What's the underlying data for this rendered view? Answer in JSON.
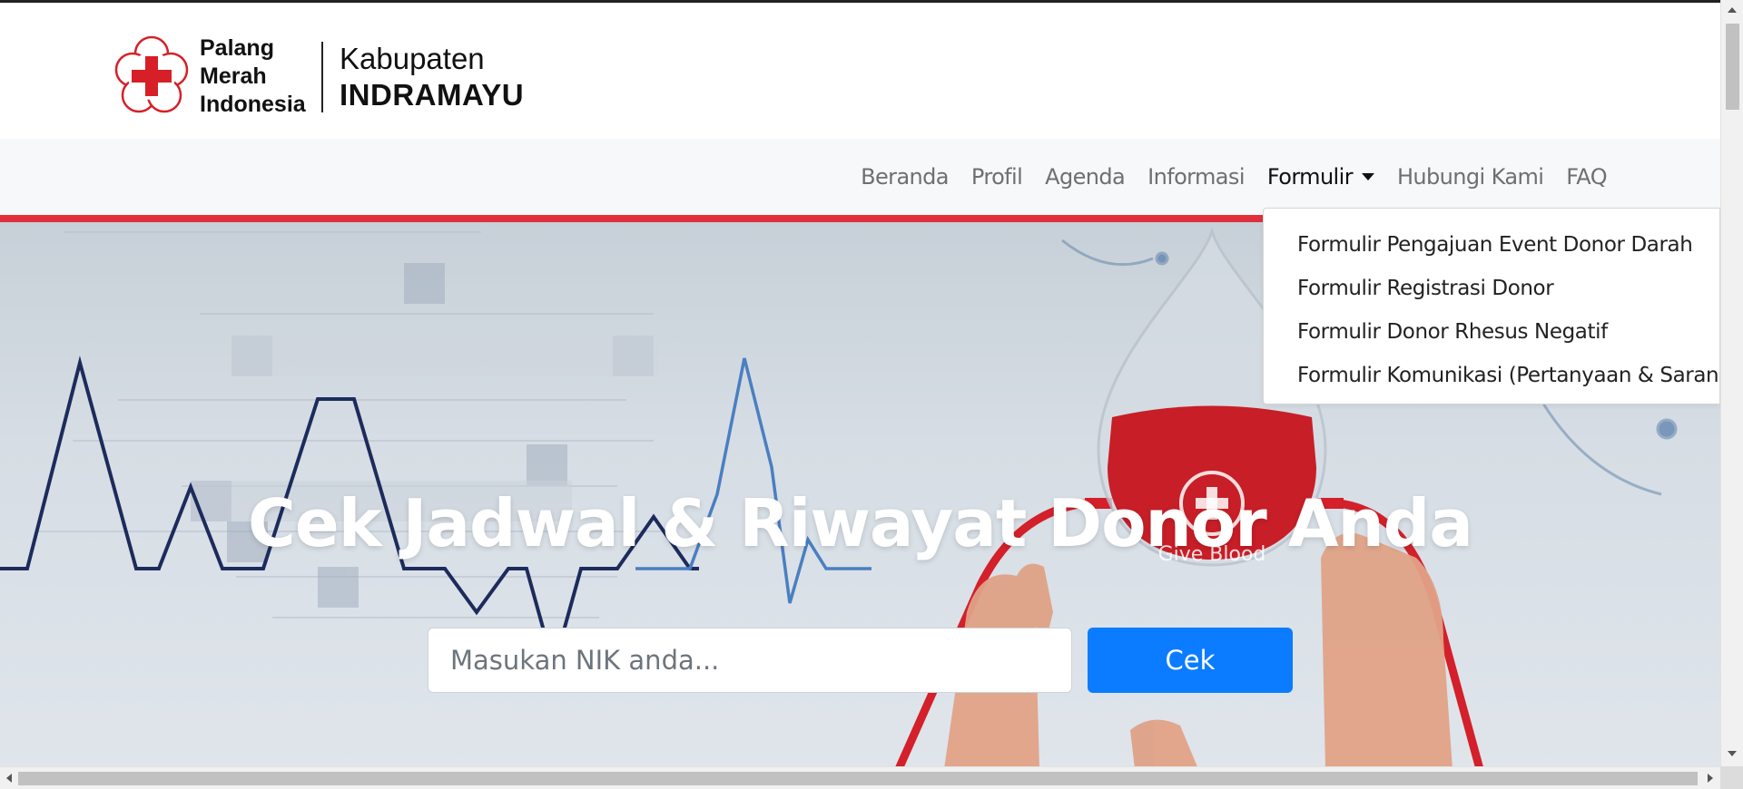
{
  "brand": {
    "pmi_line1": "Palang",
    "pmi_line2": "Merah",
    "pmi_line3": "Indonesia",
    "region_line1": "Kabupaten",
    "region_line2": "INDRAMAYU"
  },
  "nav": {
    "items": [
      {
        "label": "Beranda"
      },
      {
        "label": "Profil"
      },
      {
        "label": "Agenda"
      },
      {
        "label": "Informasi"
      },
      {
        "label": "Formulir"
      },
      {
        "label": "Hubungi Kami"
      },
      {
        "label": "FAQ"
      }
    ]
  },
  "dropdown": {
    "items": [
      {
        "label": "Formulir Pengajuan Event Donor Darah"
      },
      {
        "label": "Formulir Registrasi Donor"
      },
      {
        "label": "Formulir Donor Rhesus Negatif"
      },
      {
        "label": "Formulir Komunikasi (Pertanyaan & Saran)"
      }
    ]
  },
  "hero": {
    "title": "Cek Jadwal & Riwayat Donor Anda",
    "search_placeholder": "Masukan NIK anda...",
    "button_label": "Cek",
    "image_caption": "Give Blood"
  },
  "colors": {
    "brand_red": "#e0303c",
    "button_blue": "#0b7cff",
    "heartbeat_dark": "#1d2b5c",
    "heartbeat_light": "#4a7fc1"
  },
  "icons": {
    "logo": "red-cross-flower-icon",
    "dropdown_caret": "caret-down-icon",
    "blood_bag": "blood-drop-cross-icon"
  }
}
